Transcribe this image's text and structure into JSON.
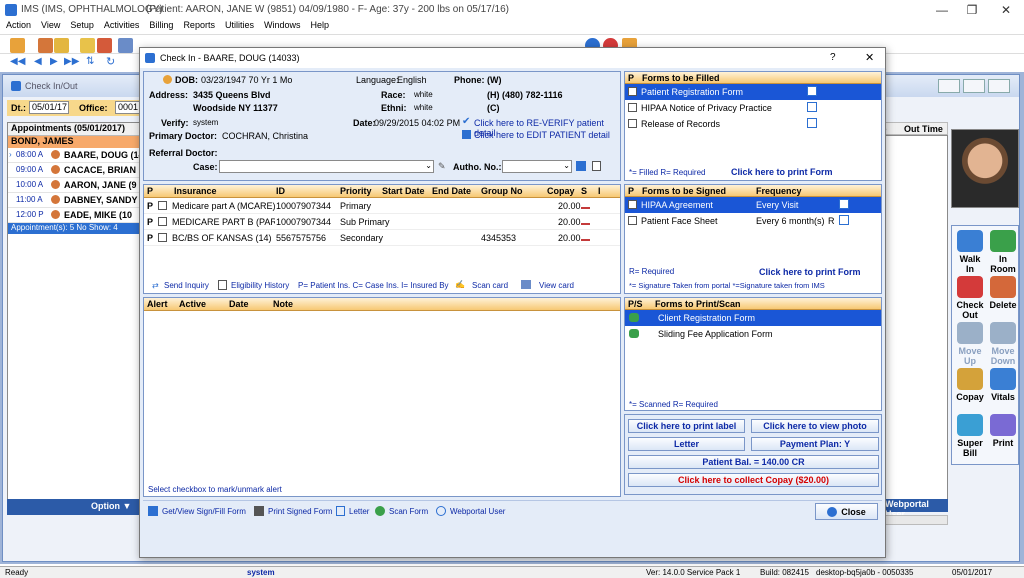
{
  "app": {
    "title_app": "IMS (IMS, OPHTHALMOLOGY)",
    "title_patient": "(Patient: AARON, JANE W (9851) 04/09/1980 - F- Age: 37y  - 200 lbs on 05/17/16)",
    "minimize": "—",
    "restore": "❐",
    "close": "✕"
  },
  "menu": [
    "Action",
    "View",
    "Setup",
    "Activities",
    "Billing",
    "Reports",
    "Utilities",
    "Windows",
    "Help"
  ],
  "checkin_panel": {
    "title": "Check In/Out",
    "date_label": "Dt.:",
    "date_value": "05/01/17",
    "office_label": "Office:",
    "office_value": "0001",
    "appt_header": "Appointments (05/01/2017)",
    "provider": "BOND, JAMES",
    "appointments": [
      {
        "time": "08:00 A",
        "name": "BAARE, DOUG  (14"
      },
      {
        "time": "09:00 A",
        "name": "CACACE, BRIAN"
      },
      {
        "time": "10:00 A",
        "name": "AARON, JANE  (9"
      },
      {
        "time": "11:00 A",
        "name": "DABNEY, SANDY"
      },
      {
        "time": "12:00 P",
        "name": "EADE, MIKE  (10"
      }
    ],
    "summary": "Appointment(s): 5   No Show: 4",
    "col_ne": "ne",
    "col_out": "Out Time",
    "option_label": "Option",
    "webportal": "Webportal User"
  },
  "right_toolbar": [
    {
      "l1": "Walk",
      "l2": "In",
      "color": "#3a7fd4"
    },
    {
      "l1": "In",
      "l2": "Room",
      "color": "#3aa04a"
    },
    {
      "l1": "Check",
      "l2": "Out",
      "color": "#d43a3a"
    },
    {
      "l1": "Delete",
      "l2": "",
      "color": "#d4683a"
    },
    {
      "l1": "Move",
      "l2": "Up",
      "color": "#9bb0c8"
    },
    {
      "l1": "Move",
      "l2": "Down",
      "color": "#9bb0c8"
    },
    {
      "l1": "Copay",
      "l2": "",
      "color": "#d4a23a"
    },
    {
      "l1": "Vitals",
      "l2": "",
      "color": "#3a7fd4"
    },
    {
      "l1": "Super",
      "l2": "Bill",
      "color": "#3a9fd4"
    },
    {
      "l1": "Print",
      "l2": "",
      "color": "#7a6ad4"
    }
  ],
  "dialog": {
    "title": "Check In - BAARE, DOUG  (14033)",
    "help": "?",
    "close": "✕",
    "patient": {
      "dob_label": "DOB:",
      "dob": "03/23/1947 70 Yr 1 Mo",
      "language_label": "Language:",
      "language": "English",
      "phone_label": "Phone:",
      "phone_w": "(W)",
      "address_label": "Address:",
      "address1": "3435 Queens Blvd",
      "address2": "Woodside  NY  11377",
      "race_label": "Race:",
      "race": "white",
      "ethni_label": "Ethni:",
      "ethni": "white",
      "phone_h": "(H)  (480) 782-1116",
      "phone_c": "(C)",
      "verify_label": "Verify:",
      "verify": "system",
      "date_label": "Date:",
      "date": "09/29/2015 04:02 PM",
      "reverify": "Click here to RE-VERIFY patient detail",
      "edit": "Click here to EDIT PATIENT detail",
      "primary_doctor_label": "Primary Doctor:",
      "primary_doctor": "COCHRAN, Christina",
      "referral_label": "Referral Doctor:",
      "case_label": "Case:",
      "autho_label": "Autho. No.:"
    },
    "insurance": {
      "headers": [
        "P",
        "Insurance",
        "ID",
        "Priority",
        "Start Date",
        "End Date",
        "Group No",
        "Copay",
        "S",
        "I"
      ],
      "rows": [
        {
          "p": "P",
          "insurance": "Medicare part A  (MCARE)",
          "id": "10007907344",
          "priority": "Primary",
          "group": "",
          "copay": "20.00"
        },
        {
          "p": "P",
          "insurance": "MEDICARE PART B  (PAR",
          "id": "10007907344",
          "priority": "Sub Primary",
          "group": "",
          "copay": "20.00"
        },
        {
          "p": "P",
          "insurance": "BC/BS OF KANSAS  (14)",
          "id": "5567575756",
          "priority": "Secondary",
          "group": "4345353",
          "copay": "20.00"
        }
      ],
      "send_inquiry": "Send Inquiry",
      "eligibility": "Eligibility History",
      "legend": "P= Patient Ins. C= Case Ins. I= Insured By",
      "scan_card": "Scan card",
      "view_card": "View card"
    },
    "alerts": {
      "headers": [
        "Alert",
        "Active",
        "Date",
        "Note"
      ],
      "footer": "Select checkbox to mark/unmark alert"
    },
    "forms_filled": {
      "headers": [
        "P",
        "Forms to be Filled"
      ],
      "items": [
        "Patient Registration Form",
        "HIPAA Notice of Privacy Practice",
        "Release of Records"
      ],
      "legend": "*= Filled  R= Required",
      "print": "Click here to print Form"
    },
    "forms_signed": {
      "headers": [
        "P",
        "Forms to be Signed",
        "Frequency"
      ],
      "items": [
        {
          "name": "HIPAA Agreement",
          "freq": "Every Visit",
          "r": ""
        },
        {
          "name": "Patient Face Sheet",
          "freq": "Every 6 month(s)",
          "r": "R"
        }
      ],
      "legend1": "R= Required",
      "legend2": "*= Signature Taken from portal  *=Signature taken from IMS",
      "print": "Click here to print Form"
    },
    "forms_scan": {
      "headers": [
        "P/S",
        "Forms to Print/Scan"
      ],
      "items": [
        "Client Registration Form",
        "Sliding Fee Application Form"
      ],
      "legend": "*= Scanned   R= Required"
    },
    "buttons": {
      "print_label": "Click here to print label",
      "view_photo": "Click here to view photo",
      "letter": "Letter",
      "payment_plan": "Payment Plan: Y",
      "patient_bal": "Patient Bal. = 140.00 CR",
      "collect_copay": "Click here to collect Copay ($20.00)"
    },
    "footer": {
      "get_view": "Get/View Sign/Fill Form",
      "print_signed": "Print Signed Form",
      "letter": "Letter",
      "scan_form": "Scan Form",
      "webportal": "Webportal User",
      "close": "Close"
    }
  },
  "statusbar": {
    "ready": "Ready",
    "user": "system",
    "version": "Ver: 14.0.0 Service Pack 1",
    "build": "Build: 082415",
    "machine": "desktop-bq5ja0b - 0050335",
    "date": "05/01/2017"
  },
  "colors": {
    "accent": "#1a56d6",
    "header_orange": "#f7c873",
    "link": "#0d29a6",
    "alert_red": "#d40000"
  }
}
